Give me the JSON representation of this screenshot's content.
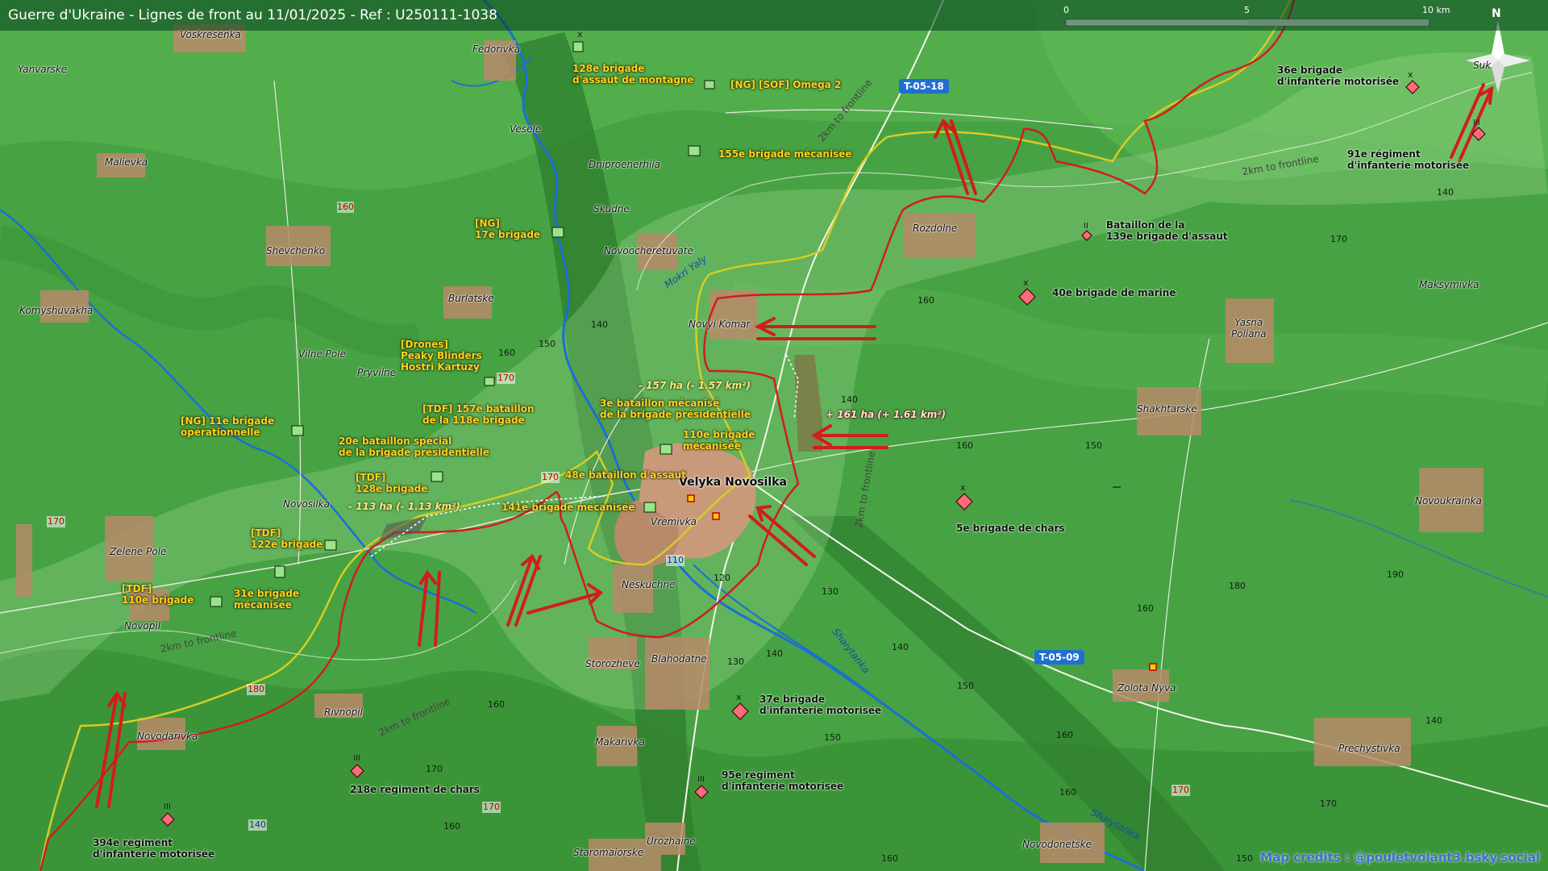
{
  "header": {
    "title": "Guerre d'Ukraine - Lignes de front au 11/01/2025 - Ref : U250111-1038"
  },
  "scale": {
    "ticks": [
      "0",
      "5",
      "10 km"
    ]
  },
  "north": "N",
  "credit": "Map credits : @pouletvolant3.bsky.social",
  "colors": {
    "frontline": "#d11d1d",
    "prior_line": "#e8d21f",
    "terrain": "#3f9a3f",
    "road_badge": "#1f6fd1"
  },
  "roads": {
    "r1": "T-05-18",
    "r2": "T-05-09",
    "r3": "110",
    "r4": "140"
  },
  "towns": {
    "voskresenka": "Voskresenka",
    "fedorivka": "Fedorivka",
    "yanvarske": "Yanvarske",
    "vesele": "Vesele",
    "malievka": "Malievka",
    "dniproenerhiia": "Dniproenerhiia",
    "skudne": "Skudne",
    "shevchenko": "Shevchenko",
    "novoocheretuvate": "Novoocheretuvate",
    "burlatske": "Burlatske",
    "komyshuvakha": "Komyshuvakha",
    "vilne_pole": "Vilne Pole",
    "pryvilne": "Pryvilne",
    "novyi_komar": "Novyi Komar",
    "rozdolne": "Rozdolne",
    "yasna_poliana": "Yasna\nPoliana",
    "maksymivka": "Maksymivka",
    "shakhtarske": "Shakhtarske",
    "velyka_novosilka": "Velyka Novosilka",
    "vremivka": "Vremivka",
    "novosilka": "Novosilka",
    "zelene_pole": "Zelene Pole",
    "neskuchne": "Neskuchne",
    "novopil": "Novopil",
    "storozheve": "Storozheve",
    "blahodatne": "Blahodatne",
    "novodarivka": "Novodarivka",
    "rivnopil": "Rivnopil",
    "makarivka": "Makarivka",
    "zolota_nyva": "Zolota Nyva",
    "novoukrainka": "Novoukrainka",
    "prechystivka": "Prechystivka",
    "staromaiorske": "Staromaiorske",
    "urozhaine": "Urozhaine",
    "novodonetske": "Novodonetske",
    "suk": "Suk"
  },
  "rivers": {
    "mokri_yaly": "Mokri Yaly",
    "shaiytanka_1": "Shaiytanka",
    "shaiytanka_2": "Shaiytanka"
  },
  "buffer_labels": {
    "b1": "2km to frontline",
    "b2": "2km to frontline",
    "b3": "2km to frontline",
    "b4": "2km to frontline",
    "b5": "2km to frontline"
  },
  "contours": [
    "160",
    "140",
    "150",
    "160",
    "170",
    "140",
    "160",
    "170",
    "150",
    "140",
    "170",
    "160",
    "190",
    "180",
    "160",
    "180",
    "170",
    "130",
    "140",
    "140",
    "120",
    "160",
    "170",
    "150",
    "160",
    "140",
    "150",
    "160",
    "150",
    "130",
    "140",
    "160",
    "170",
    "170",
    "160",
    "160",
    "160",
    "170"
  ],
  "ukr_units": {
    "u128": "128e brigade\nd'assaut de montagne",
    "omega": "[NG] [SOF] Omega 2",
    "u155": "155e brigade mécanisée",
    "ng17": "[NG]\n17e brigade",
    "drones": "[Drones]\nPeaky Blinders\nHostri Kartuzy",
    "tdf157": "[TDF] 157e bataillon\nde la 118e brigade",
    "bat3": "3e bataillon mécanisé\nde la brigade présidentielle",
    "ng11": "[NG] 11e brigade\nopérationnelle",
    "bat20": "20e bataillon spécial\nde la brigade présidentielle",
    "u110": "110e brigade\nmécanisée",
    "bat48": "48e bataillon d'assaut",
    "tdf128": "[TDF]\n128e brigade",
    "u141": "141e brigade mécanisée",
    "tdf122": "[TDF]\n122e brigade",
    "tdf110": "[TDF]\n110e brigade",
    "u31": "31e brigade\nmécanisée"
  },
  "rus_units": {
    "r36": "36e brigade\nd'infanterie motorisée",
    "r91": "91e régiment\nd'infanterie motorisée",
    "r139": "Bataillon de la\n139e brigade d'assaut",
    "r40": "40e brigade de marine",
    "r5": "5e brigade de chars",
    "r37": "37e brigade\nd'infanterie motorisée",
    "r95": "95e régiment\nd'infanterie motorisée",
    "r218": "218e régiment de chars",
    "r394": "394e régiment\nd'infanterie motorisée"
  },
  "territory_changes": {
    "loss1": "- 157 ha (- 1.57 km²)",
    "gain1": "+ 161 ha (+ 1.61 km²)",
    "loss2": "- 113 ha (- 1.13 km²)"
  },
  "echelons": {
    "x": "x",
    "ii": "II",
    "iii": "III"
  }
}
